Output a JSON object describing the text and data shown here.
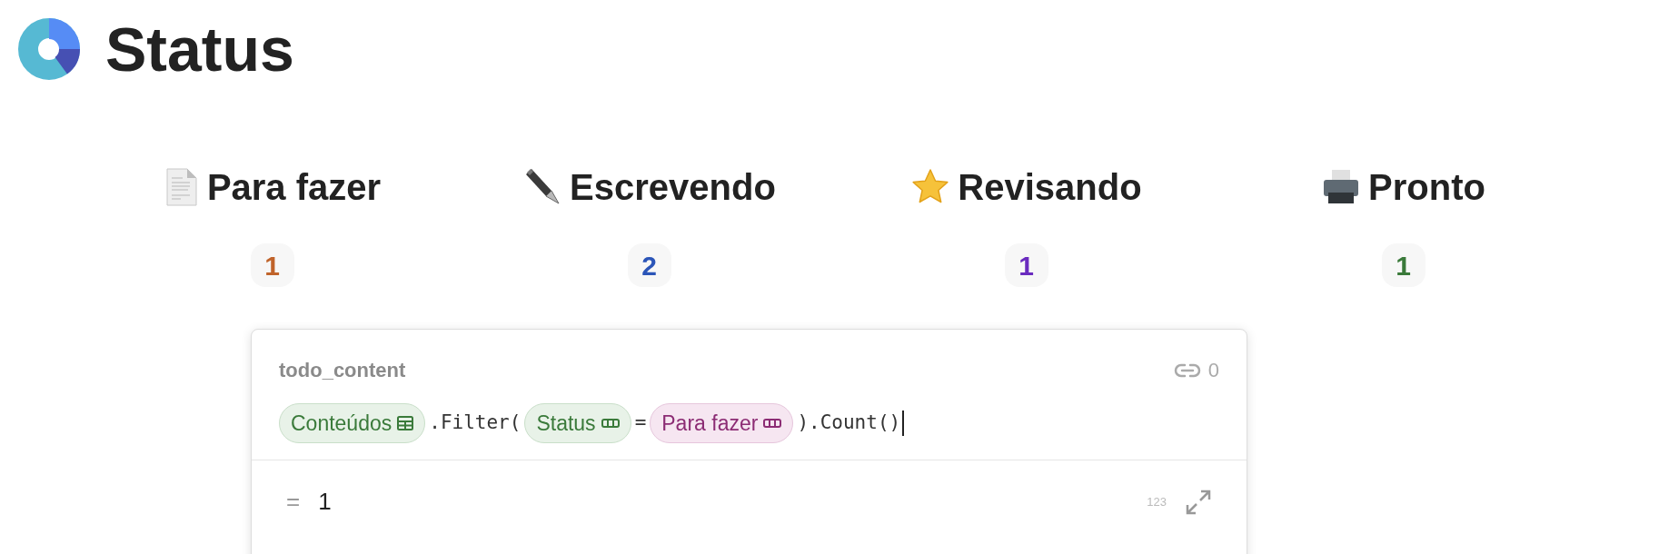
{
  "page": {
    "title": "Status"
  },
  "columns": [
    {
      "kind": "document",
      "label": "Para fazer",
      "count": "1",
      "color": "#c0632a"
    },
    {
      "kind": "pen",
      "label": "Escrevendo",
      "count": "2",
      "color": "#2b55b8"
    },
    {
      "kind": "star",
      "label": "Revisando",
      "count": "1",
      "color": "#6a2bbf"
    },
    {
      "kind": "printer",
      "label": "Pronto",
      "count": "1",
      "color": "#3a7a3a"
    }
  ],
  "formula_popup": {
    "name": "todo_content",
    "references": "0",
    "tokens": [
      {
        "kind": "database",
        "text": "Conteúdos"
      },
      {
        "kind": "code",
        "text": ".Filter("
      },
      {
        "kind": "property",
        "text": "Status"
      },
      {
        "kind": "code",
        "text": "="
      },
      {
        "kind": "option",
        "text": "Para fazer"
      },
      {
        "kind": "code",
        "text": ").Count()"
      }
    ],
    "result_prefix": "=",
    "result": "1",
    "result_type": "123"
  }
}
